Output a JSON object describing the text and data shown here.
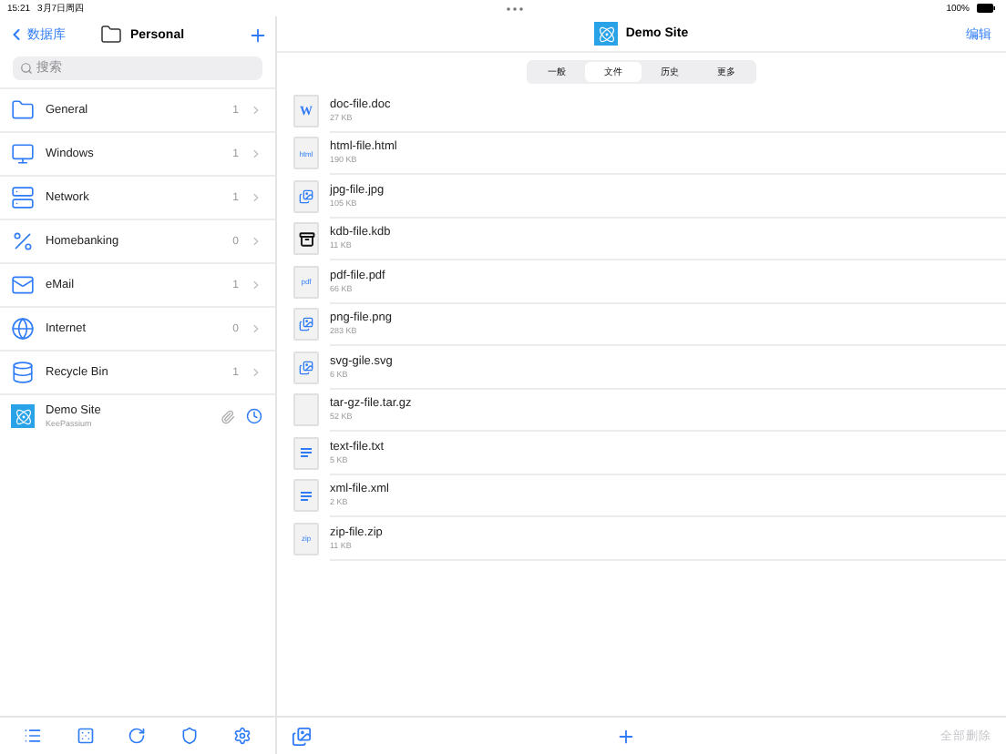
{
  "status_bar": {
    "time": "15:21",
    "date": "3月7日周四",
    "battery": "100%"
  },
  "sidebar": {
    "back": "数据库",
    "title": "Personal",
    "search": {
      "placeholder": "搜索"
    },
    "items": [
      {
        "kind": "folder",
        "name": "General",
        "count": "1"
      },
      {
        "kind": "windows",
        "name": "Windows",
        "count": "1"
      },
      {
        "kind": "network",
        "name": "Network",
        "count": "1"
      },
      {
        "kind": "percent",
        "name": "Homebanking",
        "count": "0"
      },
      {
        "kind": "email",
        "name": "eMail",
        "count": "1"
      },
      {
        "kind": "globe",
        "name": "Internet",
        "count": "0"
      },
      {
        "kind": "database",
        "name": "Recycle Bin",
        "count": "1"
      },
      {
        "kind": "entry",
        "name": "Demo Site",
        "subtitle": "KeePassium"
      }
    ]
  },
  "detail": {
    "title": "Demo Site",
    "edit": "编辑",
    "tabs": [
      {
        "label": "一般",
        "selected": false
      },
      {
        "label": "文件",
        "selected": true
      },
      {
        "label": "历史",
        "selected": false
      },
      {
        "label": "更多",
        "selected": false
      }
    ],
    "files": [
      {
        "kind": "word",
        "badge": "W",
        "name": "doc-file.doc",
        "size": "27 KB"
      },
      {
        "kind": "html",
        "badge": "html",
        "name": "html-file.html",
        "size": "190 KB"
      },
      {
        "kind": "image",
        "name": "jpg-file.jpg",
        "size": "105 KB"
      },
      {
        "kind": "kdb",
        "name": "kdb-file.kdb",
        "size": "11 KB"
      },
      {
        "kind": "pdf",
        "badge": "pdf",
        "name": "pdf-file.pdf",
        "size": "66 KB"
      },
      {
        "kind": "image",
        "name": "png-file.png",
        "size": "283 KB"
      },
      {
        "kind": "image",
        "name": "svg-gile.svg",
        "size": "6 KB"
      },
      {
        "kind": "blank",
        "name": "tar-gz-file.tar.gz",
        "size": "52 KB"
      },
      {
        "kind": "text",
        "name": "text-file.txt",
        "size": "5 KB"
      },
      {
        "kind": "text",
        "name": "xml-file.xml",
        "size": "2 KB"
      },
      {
        "kind": "zip",
        "badge": "zip",
        "name": "zip-file.zip",
        "size": "11 KB"
      }
    ],
    "delete_all": {
      "label": "全部删除",
      "disabled": true
    }
  }
}
